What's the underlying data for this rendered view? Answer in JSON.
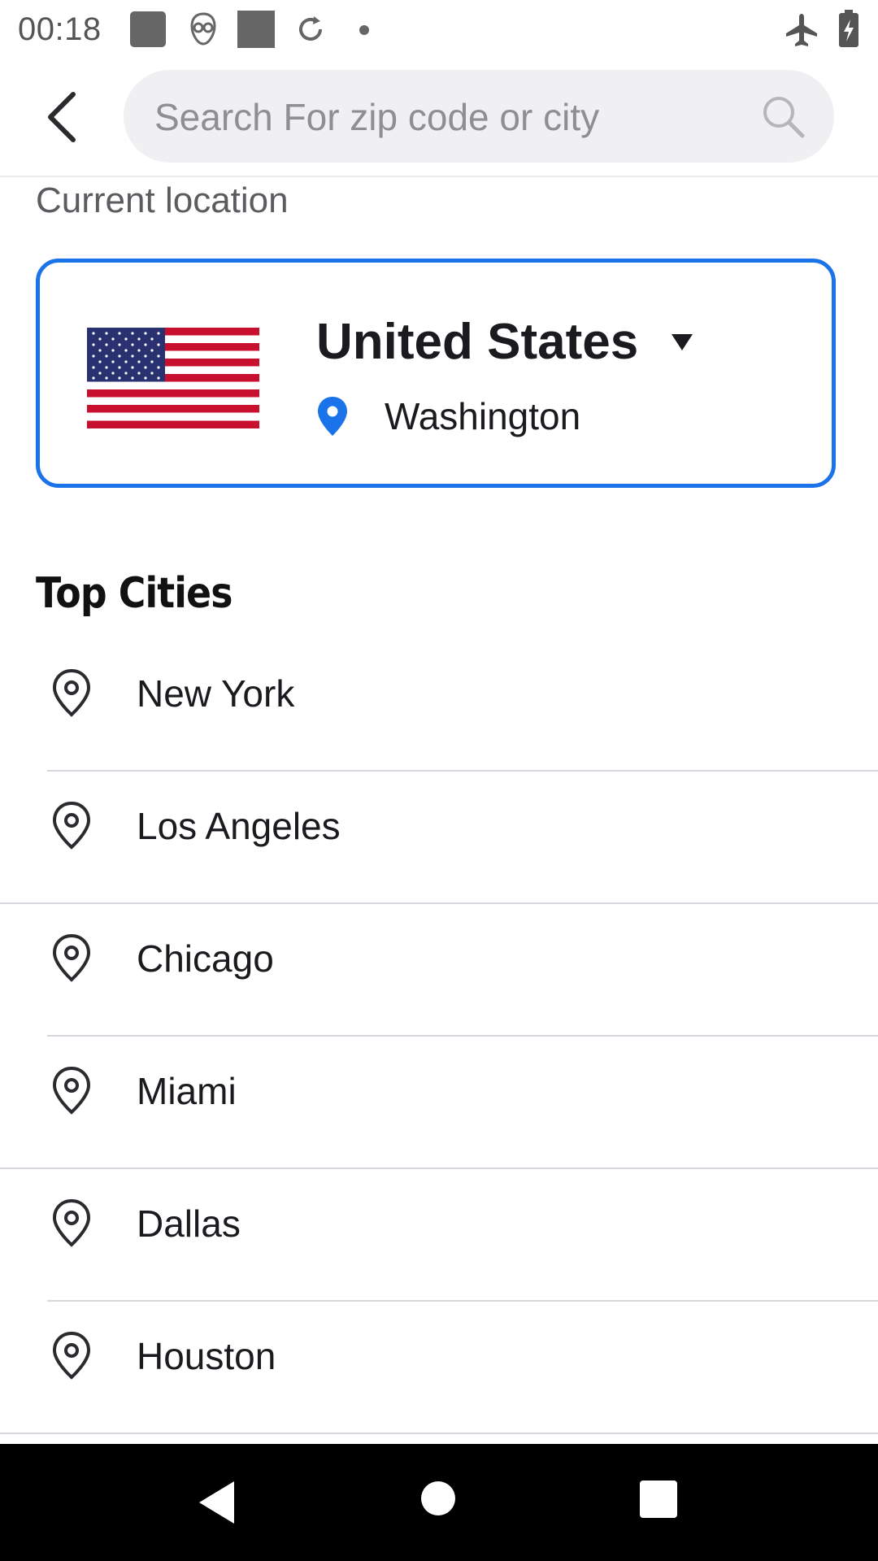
{
  "status_bar": {
    "time": "00:18",
    "left_icons": [
      "app-square-icon",
      "alien-face-icon",
      "app-square-icon",
      "sync-icon",
      "dot-icon"
    ],
    "right_icons": [
      "airplane-mode-icon",
      "battery-charging-icon"
    ]
  },
  "header": {
    "back_icon": "back-arrow-icon",
    "search": {
      "placeholder": "Search For zip code or city",
      "value": "",
      "icon": "search-icon"
    }
  },
  "current_location": {
    "label": "Current location",
    "country": "United States",
    "city": "Washington",
    "flag": "us-flag",
    "accent_color": "#1a73e8"
  },
  "top_cities": {
    "heading": "Top Cities",
    "items": [
      {
        "name": "New York",
        "icon": "location-pin-icon"
      },
      {
        "name": "Los Angeles",
        "icon": "location-pin-icon"
      },
      {
        "name": "Chicago",
        "icon": "location-pin-icon"
      },
      {
        "name": "Miami",
        "icon": "location-pin-icon"
      },
      {
        "name": "Dallas",
        "icon": "location-pin-icon"
      },
      {
        "name": "Houston",
        "icon": "location-pin-icon"
      }
    ]
  },
  "nav_bar": {
    "buttons": [
      "nav-back-icon",
      "nav-home-icon",
      "nav-recents-icon"
    ]
  }
}
